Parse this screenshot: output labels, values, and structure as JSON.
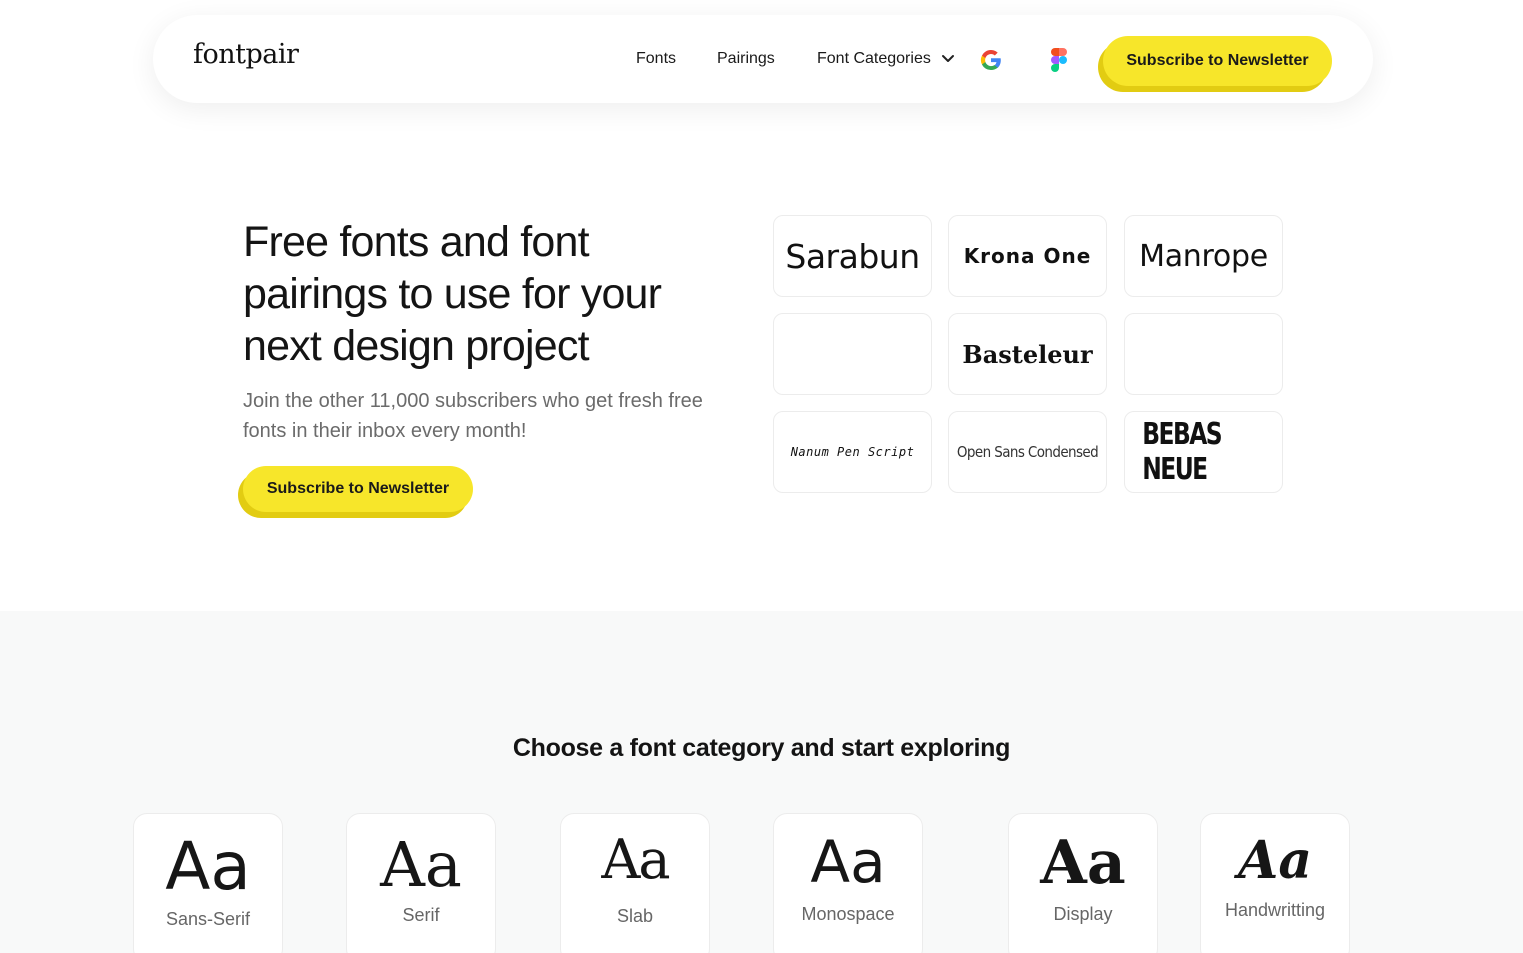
{
  "nav": {
    "logo": "fontpair",
    "links": [
      "Fonts",
      "Pairings",
      "Font Categories"
    ],
    "icons": [
      "google-icon",
      "figma-icon",
      "chevron-down-icon"
    ],
    "subscribe_label": "Subscribe to Newsletter"
  },
  "hero": {
    "title": "Free fonts and font pairings to use for your next design project",
    "subtitle": "Join the other 11,000 subscribers who get fresh free fonts in their inbox every month!",
    "button_label": "Subscribe to Newsletter"
  },
  "font_tiles": [
    "Sarabun",
    "Krona One",
    "Manrope",
    "",
    "Basteleur",
    "",
    "Nanum Pen Script",
    "Open Sans Condensed",
    "BEBAS NEUE"
  ],
  "categories": {
    "heading": "Choose a font category and start exploring",
    "items": [
      {
        "sample": "Aa",
        "label": "Sans-Serif"
      },
      {
        "sample": "Aa",
        "label": "Serif"
      },
      {
        "sample": "Aa",
        "label": "Slab"
      },
      {
        "sample": "Aa",
        "label": "Monospace"
      },
      {
        "sample": "Aa",
        "label": "Display"
      },
      {
        "sample": "Aa",
        "label": "Handwritting"
      }
    ]
  },
  "colors": {
    "accent_yellow": "#f7e62a",
    "accent_yellow_shadow": "#e2cc12",
    "section_bg": "#f8f9f9"
  }
}
